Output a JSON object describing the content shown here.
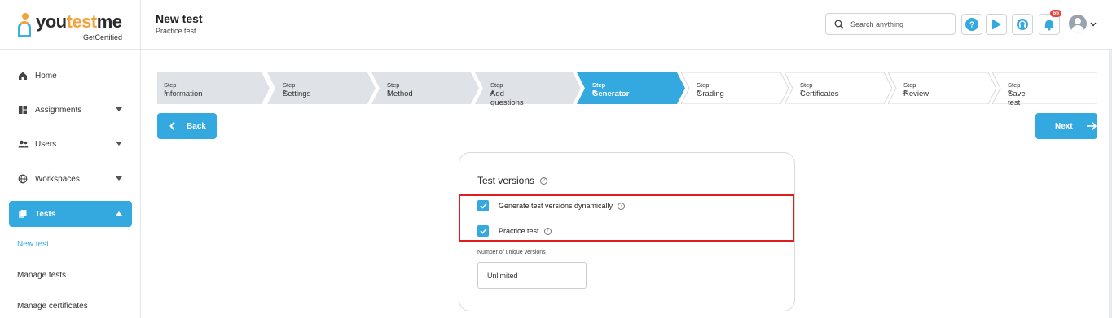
{
  "brand": {
    "name_part1": "you",
    "name_part2": "test",
    "name_part3": "me",
    "tagline": "GetCertified",
    "accent": "#f2a33c",
    "primary": "#34a9df"
  },
  "sidebar": {
    "items": [
      {
        "label": "Home",
        "icon": "home-icon"
      },
      {
        "label": "Assignments",
        "icon": "assignments-icon"
      },
      {
        "label": "Users",
        "icon": "users-icon"
      },
      {
        "label": "Workspaces",
        "icon": "globe-icon"
      },
      {
        "label": "Tests",
        "icon": "tests-icon"
      }
    ],
    "sub_items": [
      {
        "label": "New test"
      },
      {
        "label": "Manage tests"
      },
      {
        "label": "Manage certificates"
      }
    ]
  },
  "header": {
    "title": "New test",
    "subtitle": "Practice test",
    "search_placeholder": "Search anything",
    "notification_count": "65"
  },
  "stepper": {
    "steps": [
      {
        "num": "Step 1",
        "label": "Information",
        "state": "done"
      },
      {
        "num": "Step 2",
        "label": "Settings",
        "state": "done"
      },
      {
        "num": "Step 3",
        "label": "Method",
        "state": "done"
      },
      {
        "num": "Step 4",
        "label": "Add questions",
        "state": "done"
      },
      {
        "num": "Step 5",
        "label": "Generator",
        "state": "active"
      },
      {
        "num": "Step 6",
        "label": "Grading",
        "state": "todo"
      },
      {
        "num": "Step 7",
        "label": "Certificates",
        "state": "todo"
      },
      {
        "num": "Step 8",
        "label": "Review",
        "state": "todo"
      },
      {
        "num": "Step 9",
        "label": "Save test",
        "state": "todo"
      }
    ]
  },
  "nav": {
    "back_label": "Back",
    "next_label": "Next"
  },
  "card": {
    "title": "Test versions",
    "options": [
      {
        "label": "Generate test versions dynamically",
        "checked": true
      },
      {
        "label": "Practice test",
        "checked": true
      }
    ],
    "field_label": "Number of unique versions",
    "field_value": "Unlimited"
  }
}
